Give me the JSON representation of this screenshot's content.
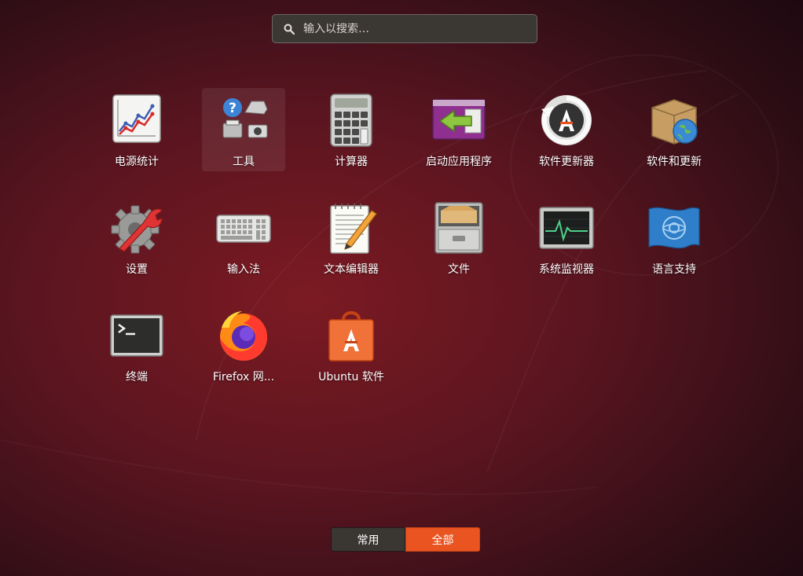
{
  "search": {
    "placeholder": "输入以搜索…",
    "icon": "search-icon"
  },
  "apps": [
    {
      "id": "power-statistics",
      "label": "电源统计",
      "icon": "power-statistics-icon"
    },
    {
      "id": "tools",
      "label": "工具",
      "icon": "tools-folder-icon",
      "selected": true
    },
    {
      "id": "calculator",
      "label": "计算器",
      "icon": "calculator-icon"
    },
    {
      "id": "startup-applications",
      "label": "启动应用程序",
      "icon": "startup-applications-icon"
    },
    {
      "id": "software-updater",
      "label": "软件更新器",
      "icon": "software-updater-icon"
    },
    {
      "id": "software-and-updates",
      "label": "软件和更新",
      "icon": "software-properties-icon"
    },
    {
      "id": "settings",
      "label": "设置",
      "icon": "settings-icon"
    },
    {
      "id": "input-method",
      "label": "输入法",
      "icon": "keyboard-icon"
    },
    {
      "id": "text-editor",
      "label": "文本编辑器",
      "icon": "text-editor-icon"
    },
    {
      "id": "files",
      "label": "文件",
      "icon": "file-cabinet-icon"
    },
    {
      "id": "system-monitor",
      "label": "系统监视器",
      "icon": "system-monitor-icon"
    },
    {
      "id": "language-support",
      "label": "语言支持",
      "icon": "language-support-icon"
    },
    {
      "id": "terminal",
      "label": "终端",
      "icon": "terminal-icon"
    },
    {
      "id": "firefox",
      "label": "Firefox 网...",
      "icon": "firefox-icon"
    },
    {
      "id": "ubuntu-software",
      "label": "Ubuntu 软件",
      "icon": "ubuntu-software-icon"
    }
  ],
  "tabs": [
    {
      "label": "常用",
      "active": false
    },
    {
      "label": "全部",
      "active": true
    }
  ],
  "colors": {
    "accent": "#e95420",
    "tab_inactive": "#3a3632",
    "search_bg": "#3b3732"
  }
}
